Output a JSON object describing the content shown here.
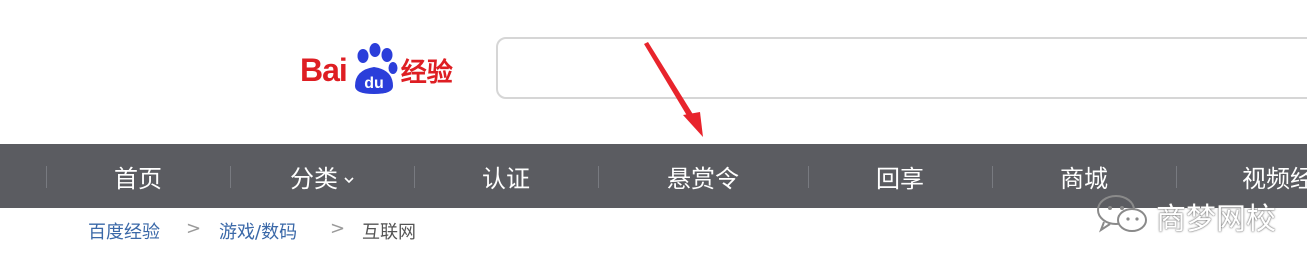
{
  "brand": {
    "logo_latin": "Bai",
    "logo_paw_text": "du",
    "logo_chinese": "经验",
    "color": "#de1e23"
  },
  "search": {
    "value": ""
  },
  "nav": {
    "items": [
      {
        "label": "首页"
      },
      {
        "label": "分类"
      },
      {
        "label": "认证"
      },
      {
        "label": "悬赏令"
      },
      {
        "label": "回享"
      },
      {
        "label": "商城"
      },
      {
        "label": "视频经"
      }
    ],
    "dropdown_icon": "chevron-down-icon",
    "background": "#5b5c61"
  },
  "breadcrumb": {
    "items": [
      "百度经验",
      "游戏/数码",
      "互联网"
    ],
    "separator": ">"
  },
  "watermark": {
    "text": "商梦网校",
    "icon": "wechat-icon"
  },
  "annotation": {
    "icon": "red-arrow-icon",
    "color": "#e8242c"
  }
}
